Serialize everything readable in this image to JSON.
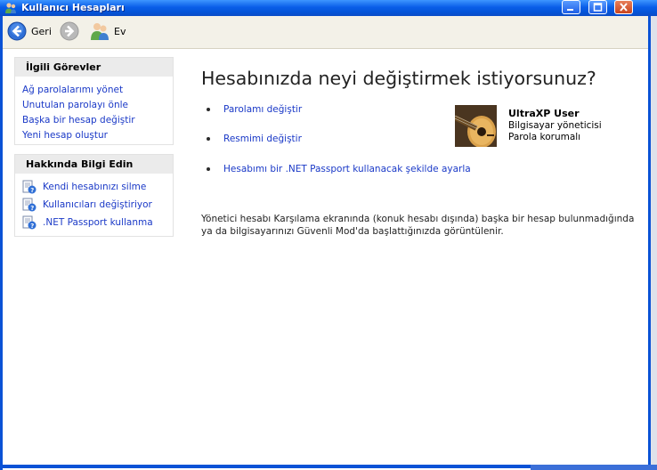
{
  "window": {
    "title": "Kullanıcı Hesapları"
  },
  "toolbar": {
    "back_label": "Geri",
    "home_label": "Ev"
  },
  "sidebar": {
    "related": {
      "heading": "İlgili Görevler",
      "items": [
        {
          "label": "Ağ parolalarımı yönet"
        },
        {
          "label": "Unutulan parolayı önle"
        },
        {
          "label": "Başka bir hesap değiştir"
        },
        {
          "label": "Yeni hesap oluştur"
        }
      ]
    },
    "learn": {
      "heading": "Hakkında Bilgi Edin",
      "items": [
        {
          "label": "Kendi hesabınızı silme",
          "icon": "help-document-icon"
        },
        {
          "label": "Kullanıcıları değiştiriyor",
          "icon": "help-document-icon"
        },
        {
          "label": ".NET Passport kullanma",
          "icon": "help-document-icon"
        }
      ]
    }
  },
  "main": {
    "title": "Hesabınızda neyi değiştirmek istiyorsunuz?",
    "options": [
      {
        "label": "Parolamı değiştir"
      },
      {
        "label": "Resmimi değiştir"
      },
      {
        "label": "Hesabımı bir .NET Passport kullanacak şekilde ayarla"
      }
    ],
    "user": {
      "name": "UltraXP User",
      "role": "Bilgisayar yöneticisi",
      "status": "Parola korumalı",
      "picture": "guitar-picture"
    },
    "note": "Yönetici hesabı Karşılama ekranında (konuk hesabı dışında) başka bir hesap bulunmadığında ya da bilgisayarınızı Güvenli Mod'da başlattığınızda görüntülenir."
  },
  "colors": {
    "link": "#1a39c7",
    "titlebar": "#0a5ee8",
    "panel_header": "#ebebeb",
    "toolbar": "#f3f1e8"
  }
}
